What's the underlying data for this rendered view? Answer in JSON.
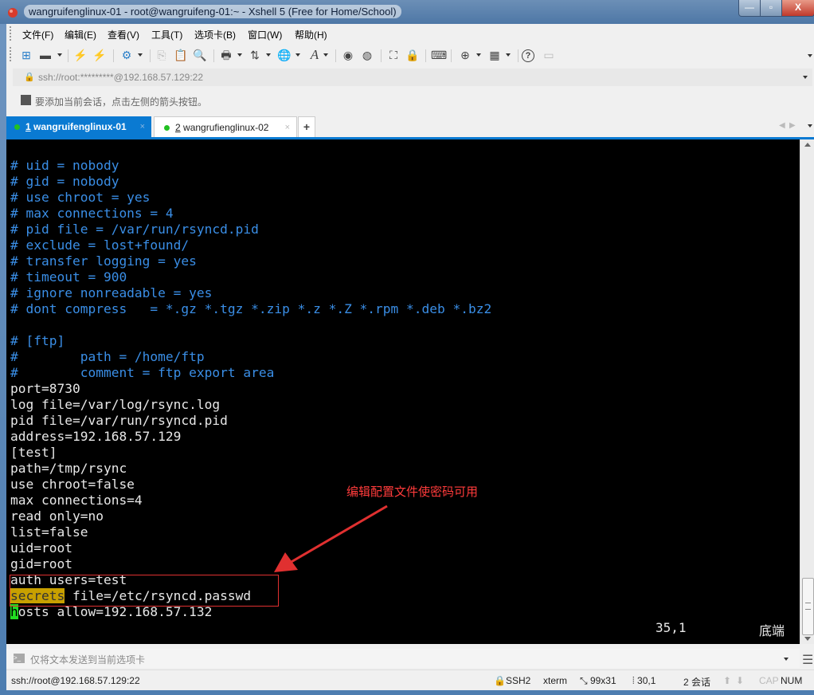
{
  "window": {
    "title": "wangruifenglinux-01 - root@wangruifeng-01:~ - Xshell 5 (Free for Home/School)",
    "controls": {
      "minimize": "—",
      "maximize": "▫",
      "close": "X"
    }
  },
  "menubar": {
    "items": [
      "文件(F)",
      "编辑(E)",
      "查看(V)",
      "工具(T)",
      "选项卡(B)",
      "窗口(W)",
      "帮助(H)"
    ]
  },
  "toolbar": {
    "icons": [
      {
        "name": "new-session-icon",
        "glyph": "⊞"
      },
      {
        "name": "open-folder-icon",
        "glyph": "▬"
      },
      {
        "name": "connect-icon",
        "glyph": "⚡"
      },
      {
        "name": "disconnect-icon",
        "glyph": "⚡"
      },
      {
        "name": "properties-icon",
        "glyph": "⚙"
      },
      {
        "name": "copy-icon",
        "glyph": "⎘"
      },
      {
        "name": "paste-icon",
        "glyph": "📋"
      },
      {
        "name": "find-icon",
        "glyph": "🔍"
      },
      {
        "name": "print-icon",
        "glyph": "🖶"
      },
      {
        "name": "transfer-icon",
        "glyph": "⇅"
      },
      {
        "name": "globe-icon",
        "glyph": "🌐"
      },
      {
        "name": "font-icon",
        "glyph": "A"
      },
      {
        "name": "xftp-icon",
        "glyph": "◉"
      },
      {
        "name": "xmanager-icon",
        "glyph": "◍"
      },
      {
        "name": "fullscreen-icon",
        "glyph": "⛶"
      },
      {
        "name": "lock-icon",
        "glyph": "🔒"
      },
      {
        "name": "keyboard-icon",
        "glyph": "⌨"
      },
      {
        "name": "new-tab-icon",
        "glyph": "⊕"
      },
      {
        "name": "layout-icon",
        "glyph": "▦"
      },
      {
        "name": "help-icon",
        "glyph": "?"
      },
      {
        "name": "chat-icon",
        "glyph": "▭"
      }
    ]
  },
  "address": {
    "value": "ssh://root:*********@192.168.57.129:22"
  },
  "hint": {
    "text": "要添加当前会话，点击左侧的箭头按钮。"
  },
  "tabs": [
    {
      "number": "1",
      "label": "wangruifenglinux-01",
      "active": true,
      "close": "×"
    },
    {
      "number": "2",
      "label": "wangrufienglinux-02",
      "active": false,
      "close": "×"
    }
  ],
  "tab_add": "+",
  "terminal": {
    "lines": [
      {
        "type": "comment",
        "text": "# uid = nobody"
      },
      {
        "type": "comment",
        "text": "# gid = nobody"
      },
      {
        "type": "comment",
        "text": "# use chroot = yes"
      },
      {
        "type": "comment",
        "text": "# max connections = 4"
      },
      {
        "type": "comment",
        "text": "# pid file = /var/run/rsyncd.pid"
      },
      {
        "type": "comment",
        "text": "# exclude = lost+found/"
      },
      {
        "type": "comment",
        "text": "# transfer logging = yes"
      },
      {
        "type": "comment",
        "text": "# timeout = 900"
      },
      {
        "type": "comment",
        "text": "# ignore nonreadable = yes"
      },
      {
        "type": "comment",
        "text": "# dont compress   = *.gz *.tgz *.zip *.z *.Z *.rpm *.deb *.bz2"
      },
      {
        "type": "normal",
        "text": ""
      },
      {
        "type": "comment",
        "text": "# [ftp]"
      },
      {
        "type": "comment",
        "text": "#        path = /home/ftp"
      },
      {
        "type": "comment",
        "text": "#        comment = ftp export area"
      },
      {
        "type": "normal",
        "text": "port=8730"
      },
      {
        "type": "normal",
        "text": "log file=/var/log/rsync.log"
      },
      {
        "type": "normal",
        "text": "pid file=/var/run/rsyncd.pid"
      },
      {
        "type": "normal",
        "text": "address=192.168.57.129"
      },
      {
        "type": "normal",
        "text": "[test]"
      },
      {
        "type": "normal",
        "text": "path=/tmp/rsync"
      },
      {
        "type": "normal",
        "text": "use chroot=false"
      },
      {
        "type": "normal",
        "text": "max connections=4"
      },
      {
        "type": "normal",
        "text": "read only=no"
      },
      {
        "type": "normal",
        "text": "list=false"
      },
      {
        "type": "normal",
        "text": "uid=root"
      },
      {
        "type": "normal",
        "text": "gid=root"
      },
      {
        "type": "normal",
        "text": "auth users=test"
      }
    ],
    "secrets_line": {
      "highlight": "secrets",
      "rest": " file=/etc/rsyncd.passwd"
    },
    "cursor_line": {
      "cursor_char": "h",
      "rest": "osts allow=192.168.57.132"
    },
    "vim_position": "35,1",
    "vim_where": "底端",
    "colors": {
      "comment": "#3a8ee6",
      "normal": "#e8e8e8",
      "search_highlight": "#c8a000",
      "cursor": "#22dd22"
    }
  },
  "annotation": {
    "text": "编辑配置文件使密码可用",
    "color": "#e03030"
  },
  "compose": {
    "placeholder": "仅将文本发送到当前选项卡"
  },
  "statusbar": {
    "connection": "ssh://root@192.168.57.129:22",
    "protocol": "SSH2",
    "terminal_type": "xterm",
    "size": "99x31",
    "cursor_pos": "30,1",
    "sessions": "2 会话",
    "cap": "CAP",
    "num": "NUM"
  },
  "accent_color": "#0a7ad2"
}
